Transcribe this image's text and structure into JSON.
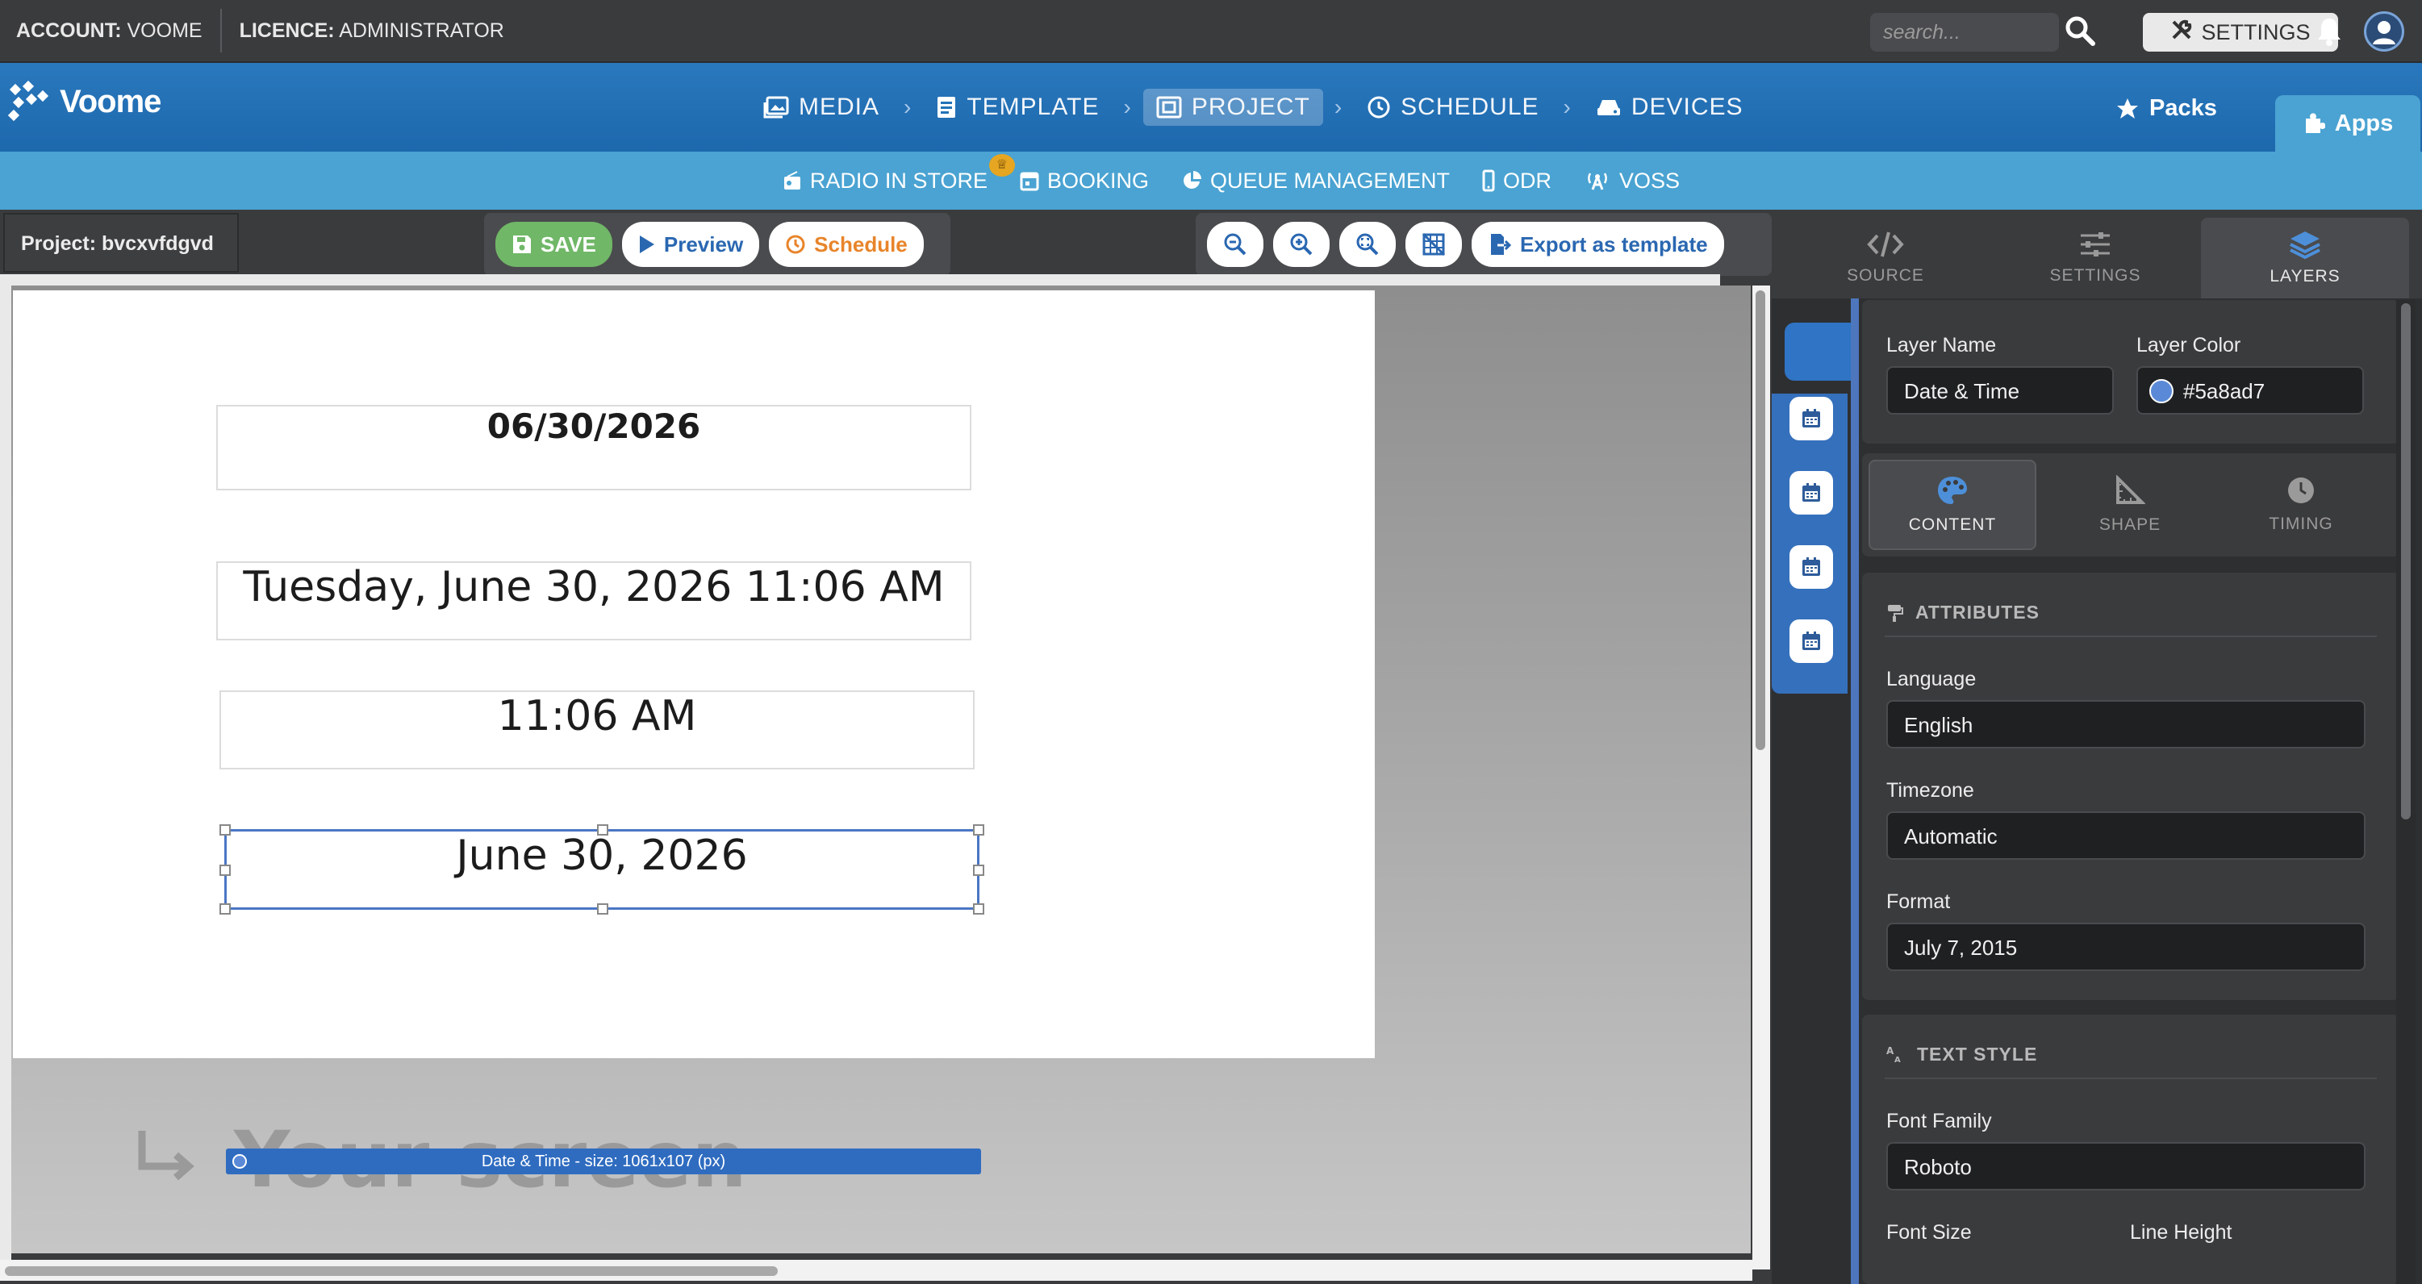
{
  "topbar": {
    "account_key": "ACCOUNT:",
    "account_value": "VOOME",
    "licence_key": "LICENCE:",
    "licence_value": "ADMINISTRATOR",
    "search_placeholder": "search...",
    "settings_label": "SETTINGS"
  },
  "nav": {
    "brand": "Voome",
    "steps": [
      {
        "label": "MEDIA",
        "icon": "image-icon"
      },
      {
        "label": "TEMPLATE",
        "icon": "template-icon"
      },
      {
        "label": "PROJECT",
        "icon": "project-icon",
        "active": true
      },
      {
        "label": "SCHEDULE",
        "icon": "clock-icon"
      },
      {
        "label": "DEVICES",
        "icon": "device-icon"
      }
    ],
    "packs": "Packs",
    "apps": "Apps"
  },
  "apps_bar": [
    {
      "label": "RADIO IN STORE",
      "icon": "radio-icon",
      "premium": true
    },
    {
      "label": "BOOKING",
      "icon": "calendar-icon"
    },
    {
      "label": "QUEUE MANAGEMENT",
      "icon": "pie-icon"
    },
    {
      "label": "ODR",
      "icon": "mobile-icon"
    },
    {
      "label": "VOSS",
      "icon": "antenna-icon"
    }
  ],
  "toolbar": {
    "project_label": "Project: bvcxvfdgvd",
    "save": "SAVE",
    "preview": "Preview",
    "schedule": "Schedule",
    "export": "Export as template"
  },
  "canvas": {
    "items": [
      {
        "text": "06/30/2026"
      },
      {
        "text": "Tuesday, June 30, 2026 11:06 AM"
      },
      {
        "text": "11:06 AM"
      },
      {
        "text": "June 30, 2026"
      }
    ],
    "selection_label": "Date & Time - size: 1061x107 (px)",
    "your_screen": "Your screen"
  },
  "panel": {
    "tabs": [
      "SOURCE",
      "SETTINGS",
      "LAYERS"
    ],
    "layer_name_label": "Layer Name",
    "layer_name_value": "Date & Time",
    "layer_color_label": "Layer Color",
    "layer_color_value": "#5a8ad7",
    "content_tabs": [
      "CONTENT",
      "SHAPE",
      "TIMING"
    ],
    "attributes_title": "ATTRIBUTES",
    "language_label": "Language",
    "language_value": "English",
    "timezone_label": "Timezone",
    "timezone_value": "Automatic",
    "format_label": "Format",
    "format_value": "July 7, 2015",
    "text_style_title": "TEXT STYLE",
    "font_family_label": "Font Family",
    "font_family_value": "Roboto",
    "font_size_label": "Font Size",
    "line_height_label": "Line Height"
  },
  "colors": {
    "brand_blue": "#1d68ad",
    "apps_bar": "#4aa3d2",
    "layer_color": "#5a8ad7",
    "save_green": "#70b767",
    "schedule_orange": "#e8842a"
  }
}
